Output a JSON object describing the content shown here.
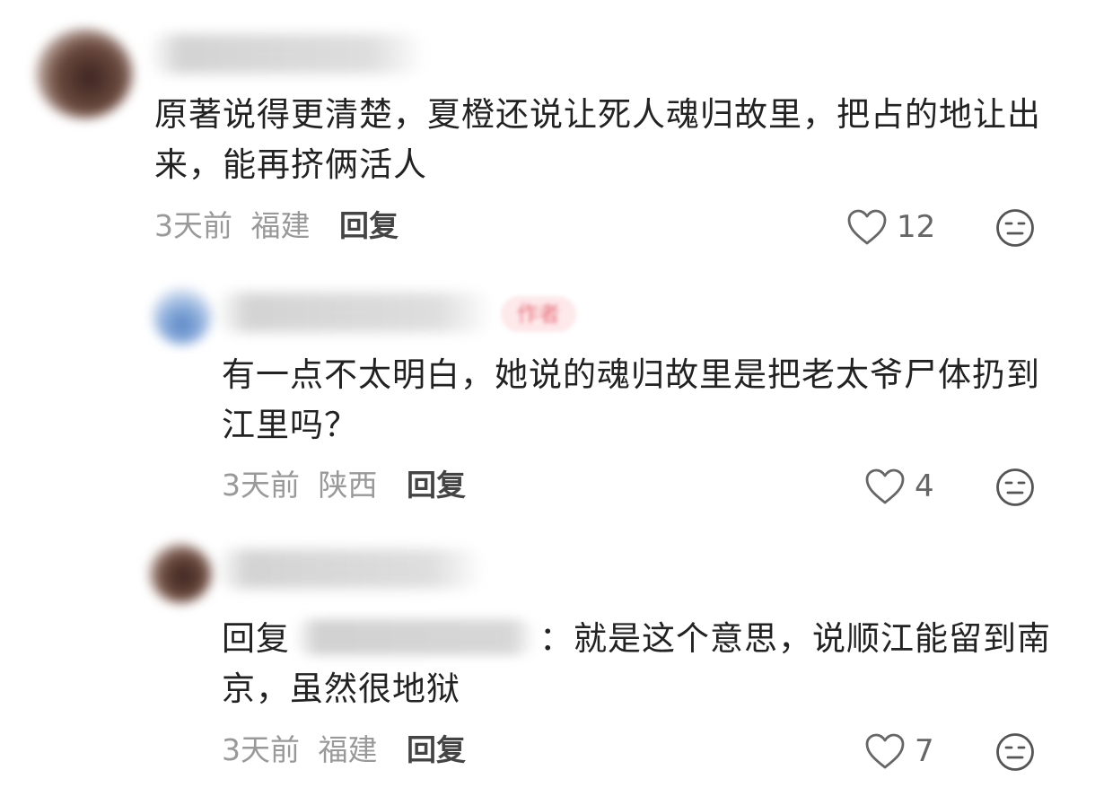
{
  "comments": [
    {
      "text": "原著说得更清楚，夏橙还说让死人魂归故里，把占的地让出来，能再挤俩活人",
      "time": "3天前",
      "location": "福建",
      "reply_label": "回复",
      "likes": "12"
    },
    {
      "author_tag": "作者",
      "text": "有一点不太明白，她说的魂归故里是把老太爷尸体扔到江里吗？",
      "time": "3天前",
      "location": "陕西",
      "reply_label": "回复",
      "likes": "4"
    },
    {
      "reply_prefix": "回复",
      "text": "：就是这个意思，说顺江能留到南京，虽然很地狱",
      "time": "3天前",
      "location": "福建",
      "reply_label": "回复",
      "likes": "7"
    }
  ],
  "icons": {
    "like": "heart-outline-icon",
    "dislike": "neutral-face-icon"
  },
  "colors": {
    "author_tag_bg": "#fde8ea",
    "author_tag_text": "#e8767f",
    "meta": "#999999",
    "body": "#222222"
  }
}
